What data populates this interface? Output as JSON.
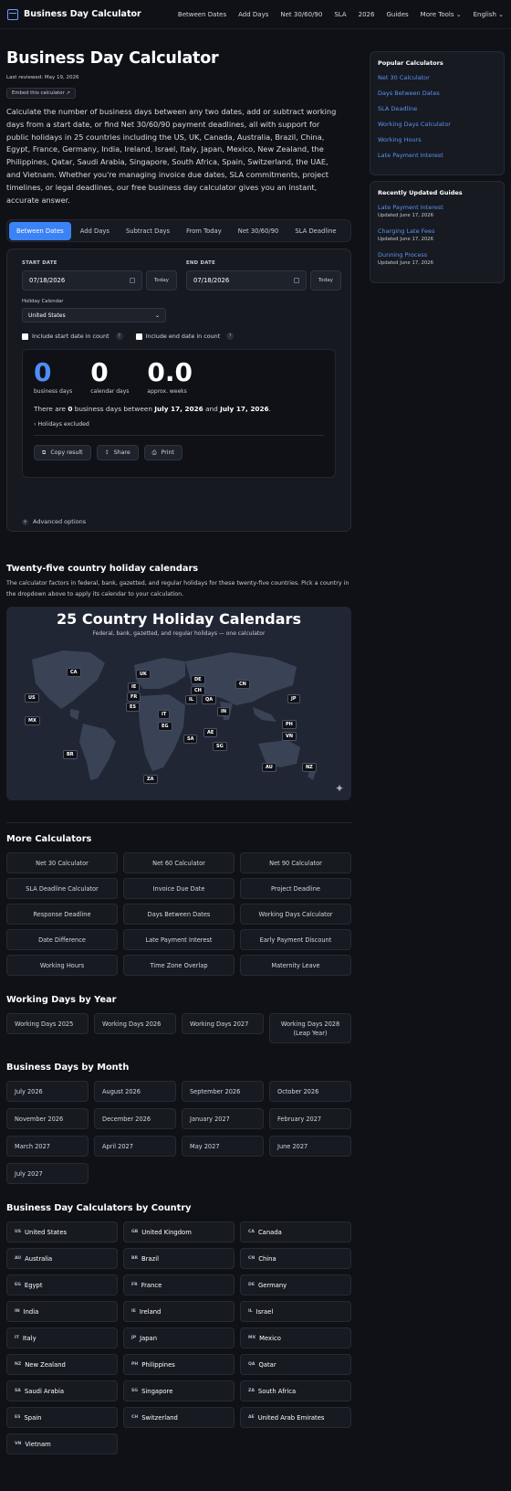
{
  "header": {
    "brand": "Business Day Calculator",
    "links": [
      "Between Dates",
      "Add Days",
      "Net 30/60/90",
      "SLA",
      "2026",
      "Guides"
    ],
    "more_tools": "More Tools",
    "language": "English"
  },
  "page": {
    "title": "Business Day Calculator",
    "reviewed": "Last reviewed: May 19, 2026",
    "embed": "Embed this calculator ↗",
    "intro": "Calculate the number of business days between any two dates, add or subtract working days from a start date, or find Net 30/60/90 payment deadlines, all with support for public holidays in 25 countries including the US, UK, Canada, Australia, Brazil, China, Egypt, France, Germany, India, Ireland, Israel, Italy, Japan, Mexico, New Zealand, the Philippines, Qatar, Saudi Arabia, Singapore, South Africa, Spain, Switzerland, the UAE, and Vietnam. Whether you're managing invoice due dates, SLA commitments, project timelines, or legal deadlines, our free business day calculator gives you an instant, accurate answer."
  },
  "tabs": [
    "Between Dates",
    "Add Days",
    "Subtract Days",
    "From Today",
    "Net 30/60/90",
    "SLA Deadline"
  ],
  "calc": {
    "start_label": "START DATE",
    "start_value": "07/18/2026",
    "end_label": "END DATE",
    "end_value": "07/18/2026",
    "today": "Today",
    "holiday_label": "Holiday Calendar",
    "holiday_value": "United States",
    "include_start": "Include start date in count",
    "include_end": "Include end date in count",
    "q": "?",
    "business_days": "0",
    "business_days_label": "business days",
    "calendar_days": "0",
    "calendar_days_label": "calendar days",
    "weeks": "0.0",
    "weeks_label": "approx. weeks",
    "s1": "There are ",
    "s_count": "0",
    "s2": " business days between ",
    "s_from": "July 17, 2026",
    "s3": " and ",
    "s_to": "July 17, 2026",
    "s4": ".",
    "holidays_excluded": "Holidays excluded",
    "copy": "Copy result",
    "share": "Share",
    "print": "Print",
    "advanced": "Advanced options"
  },
  "holidays": {
    "title": "Twenty-five country holiday calendars",
    "desc": "The calculator factors in federal, bank, gazetted, and regular holidays for these twenty-five countries. Pick a country in the dropdown above to apply its calendar to your calculation.",
    "map_title": "25 Country Holiday Calendars",
    "map_sub": "Federal, bank, gazetted, and regular holidays — one calculator",
    "pins": [
      "CA",
      "US",
      "MX",
      "BR",
      "UK",
      "IE",
      "FR",
      "ES",
      "DE",
      "CH",
      "IL",
      "IT",
      "EG",
      "QA",
      "SA",
      "AE",
      "IN",
      "CN",
      "JP",
      "PH",
      "VN",
      "SG",
      "AU",
      "NZ",
      "ZA"
    ]
  },
  "more": {
    "title": "More Calculators",
    "items": [
      "Net 30 Calculator",
      "Net 60 Calculator",
      "Net 90 Calculator",
      "SLA Deadline Calculator",
      "Invoice Due Date",
      "Project Deadline",
      "Response Deadline",
      "Days Between Dates",
      "Working Days Calculator",
      "Date Difference",
      "Late Payment Interest",
      "Early Payment Discount",
      "Working Hours",
      "Time Zone Overlap",
      "Maternity Leave"
    ]
  },
  "years": {
    "title": "Working Days by Year",
    "items": [
      "Working Days 2025",
      "Working Days 2026",
      "Working Days 2027",
      "Working Days 2028 (Leap Year)"
    ]
  },
  "months": {
    "title": "Business Days by Month",
    "items": [
      "July 2026",
      "August 2026",
      "September 2026",
      "October 2026",
      "November 2026",
      "December 2026",
      "January 2027",
      "February 2027",
      "March 2027",
      "April 2027",
      "May 2027",
      "June 2027",
      "July 2027"
    ]
  },
  "countries": {
    "title": "Business Day Calculators by Country",
    "items": [
      [
        "US",
        "United States"
      ],
      [
        "GB",
        "United Kingdom"
      ],
      [
        "CA",
        "Canada"
      ],
      [
        "AU",
        "Australia"
      ],
      [
        "BR",
        "Brazil"
      ],
      [
        "CN",
        "China"
      ],
      [
        "EG",
        "Egypt"
      ],
      [
        "FR",
        "France"
      ],
      [
        "DE",
        "Germany"
      ],
      [
        "IN",
        "India"
      ],
      [
        "IE",
        "Ireland"
      ],
      [
        "IL",
        "Israel"
      ],
      [
        "IT",
        "Italy"
      ],
      [
        "JP",
        "Japan"
      ],
      [
        "MX",
        "Mexico"
      ],
      [
        "NZ",
        "New Zealand"
      ],
      [
        "PH",
        "Philippines"
      ],
      [
        "QA",
        "Qatar"
      ],
      [
        "SA",
        "Saudi Arabia"
      ],
      [
        "SG",
        "Singapore"
      ],
      [
        "ZA",
        "South Africa"
      ],
      [
        "ES",
        "Spain"
      ],
      [
        "CH",
        "Switzerland"
      ],
      [
        "AE",
        "United Arab Emirates"
      ],
      [
        "VN",
        "Vietnam"
      ]
    ]
  },
  "sidebar": {
    "popular_title": "Popular Calculators",
    "popular": [
      "Net 30 Calculator",
      "Days Between Dates",
      "SLA Deadline",
      "Working Days Calculator",
      "Working Hours",
      "Late Payment Interest"
    ],
    "recent_title": "Recently Updated Guides",
    "recent": [
      {
        "title": "Late Payment Interest",
        "date": "Updated June 17, 2026"
      },
      {
        "title": "Charging Late Fees",
        "date": "Updated June 17, 2026"
      },
      {
        "title": "Dunning Process",
        "date": "Updated June 17, 2026"
      }
    ]
  },
  "colors": {
    "accent": "#3b82f6",
    "link": "#5b93f5",
    "background": "#0f1117"
  }
}
